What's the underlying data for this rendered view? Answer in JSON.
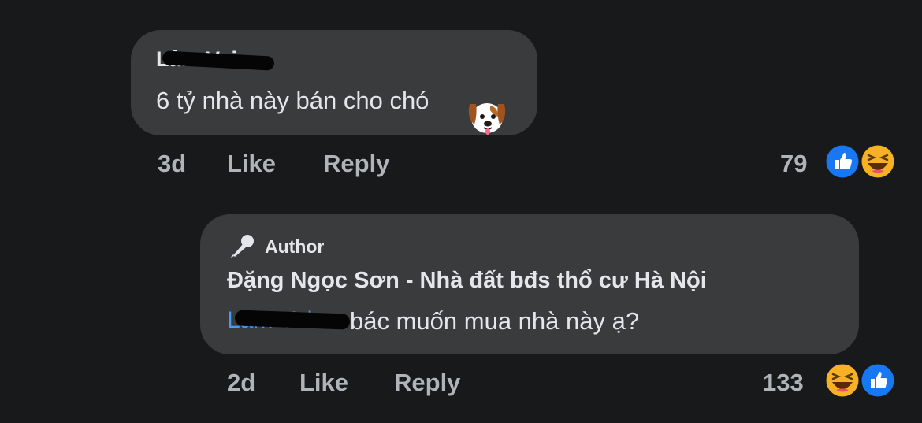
{
  "comment": {
    "author": "Lâm Voi",
    "text": "6 tỷ nhà này bán cho chó",
    "emoji": "dog-face-emoji",
    "time": "3d",
    "like_label": "Like",
    "reply_label": "Reply",
    "reaction_count": "79",
    "reactions": [
      "like-icon",
      "haha-icon"
    ]
  },
  "reply": {
    "badge_label": "Author",
    "badge_icon": "microphone-icon",
    "author": "Đặng Ngọc Sơn - Nhà đất bđs thổ cư Hà Nội",
    "mention": "Lâm Voi",
    "text": "bác muốn mua nhà này ạ?",
    "time": "2d",
    "like_label": "Like",
    "reply_label": "Reply",
    "reaction_count": "133",
    "reactions": [
      "haha-icon",
      "like-icon"
    ]
  },
  "colors": {
    "background": "#18191a",
    "bubble": "#3a3b3c",
    "text": "#e4e6eb",
    "muted": "#b0b3b8",
    "mention": "#4599ff",
    "like_blue": "#1877f2",
    "haha_yellow": "#f7b125"
  }
}
